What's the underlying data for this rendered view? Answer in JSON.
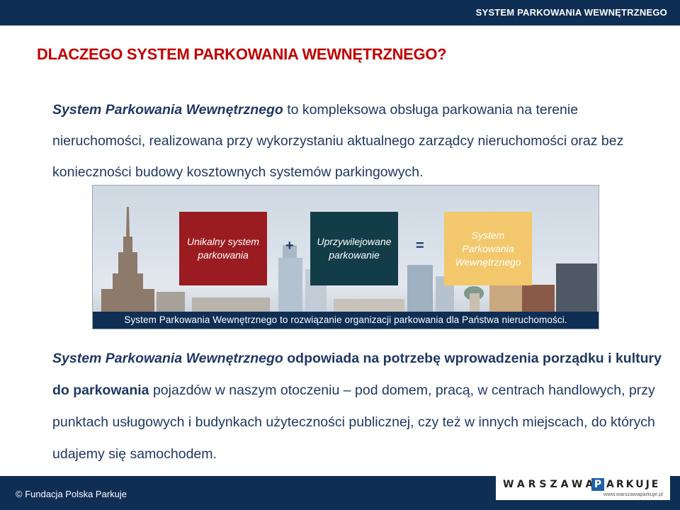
{
  "header": {
    "title": "SYSTEM PARKOWANIA WEWNĘTRZNEGO"
  },
  "heading": "DLACZEGO SYSTEM PARKOWANIA WEWNĘTRZNEGO?",
  "para1": {
    "em": "System Parkowania Wewnętrznego",
    "text": " to kompleksowa obsługa parkowania na terenie nieruchomości, realizowana przy wykorzystaniu aktualnego zarządcy nieruchomości oraz bez konieczności budowy kosztownych systemów parkingowych."
  },
  "banner": {
    "box1_line1": "Unikalny system",
    "box1_line2": "parkowania",
    "plus": "+",
    "box2_line1": "Uprzywilejowane",
    "box2_line2": "parkowanie",
    "equals": "=",
    "box3_line1": "System",
    "box3_line2": "Parkowania",
    "box3_line3": "Wewnętrznego",
    "caption": "System Parkowania Wewnętrznego to rozwiązanie organizacji parkowania dla Państwa nieruchomości.",
    "colors": {
      "red": "#9a1c20",
      "teal": "#123c48",
      "gold": "#f3c76b"
    }
  },
  "para2": {
    "em": "System Parkowania Wewnętrznego",
    "strong": " odpowiada na potrzebę wprowadzenia porządku i kultury do parkowania",
    "text": " pojazdów w naszym otoczeniu – pod domem, pracą, w centrach handlowych, przy punktach usługowych i budynkach użyteczności publicznej, czy też w innych miejscach, do których udajemy się samochodem."
  },
  "footer": {
    "copyright": "© Fundacja Polska Parkuje",
    "logo_word1": "WARSZAWA",
    "logo_p": "P",
    "logo_word2": "ARKUJE",
    "logo_url": "www.warszawaparkuje.pl"
  },
  "colors": {
    "navy": "#0f2e54",
    "heading_red": "#c00000",
    "body_text": "#1f3864"
  }
}
